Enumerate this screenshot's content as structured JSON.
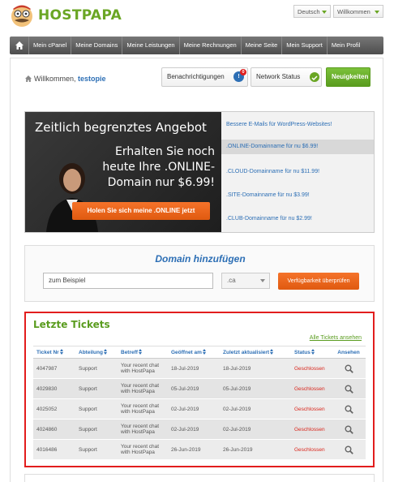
{
  "brand": {
    "logo_text": "HOSTPAPA",
    "accent": "#6aa624",
    "link": "#2d6fb5",
    "orange": "#e8621a",
    "alert": "#d9261c"
  },
  "language_select": {
    "value": "Deutsch"
  },
  "account_select": {
    "value": "Willkommen"
  },
  "nav": {
    "home_icon": "home-icon",
    "items": [
      "Mein cPanel",
      "Meine Domains",
      "Meine Leistungen",
      "Meine Rechnungen",
      "Meine Seite",
      "Mein Support",
      "Mein Profil"
    ]
  },
  "welcome": {
    "prefix": "Willkommen,",
    "user": "testopie"
  },
  "header_buttons": {
    "notifications": "Benachrichtigungen",
    "notifications_count": "0",
    "network_status": "Network Status",
    "news": "Neuigkeiten"
  },
  "promo": {
    "title": "Zeitlich begrenztes Angebot",
    "text": "Erhalten Sie noch heute Ihre .ONLINE-Domain nur $6.99!",
    "button": "Holen Sie sich meine .ONLINE jetzt",
    "links": [
      "Bessere E-Mails für WordPress-Websites!",
      ".ONLINE-Domainname für nu $6.99!",
      ".CLOUD-Domainname für nu $11.99!",
      ".SITE-Domainname für nu $3.99!",
      ".CLUB-Domainname für nu $2.99!"
    ]
  },
  "domain": {
    "title": "Domain hinzufügen",
    "input_value": "zum Beispiel",
    "tld": ".ca",
    "button": "Verfügbarkeit überprüfen"
  },
  "tickets": {
    "title": "Letzte Tickets",
    "all_link": "Alle Tickets ansehen",
    "columns": [
      "Ticket Nr",
      "Abteilung",
      "Betreff",
      "Geöffnet am",
      "Zuletzt aktualisiert",
      "Status",
      "Ansehen"
    ],
    "rows": [
      {
        "nr": "4047987",
        "dept": "Support",
        "subject": "Your recent chat with HostPapa",
        "opened": "18-Jul-2019",
        "updated": "18-Jul-2019",
        "status": "Geschlossen"
      },
      {
        "nr": "4029830",
        "dept": "Support",
        "subject": "Your recent chat with HostPapa",
        "opened": "05-Jul-2019",
        "updated": "05-Jul-2019",
        "status": "Geschlossen"
      },
      {
        "nr": "4025052",
        "dept": "Support",
        "subject": "Your recent chat with HostPapa",
        "opened": "02-Jul-2019",
        "updated": "02-Jul-2019",
        "status": "Geschlossen"
      },
      {
        "nr": "4024860",
        "dept": "Support",
        "subject": "Your recent chat with HostPapa",
        "opened": "02-Jul-2019",
        "updated": "02-Jul-2019",
        "status": "Geschlossen"
      },
      {
        "nr": "4016486",
        "dept": "Support",
        "subject": "Your recent chat with HostPapa",
        "opened": "26-Jun-2019",
        "updated": "26-Jun-2019",
        "status": "Geschlossen"
      }
    ]
  }
}
